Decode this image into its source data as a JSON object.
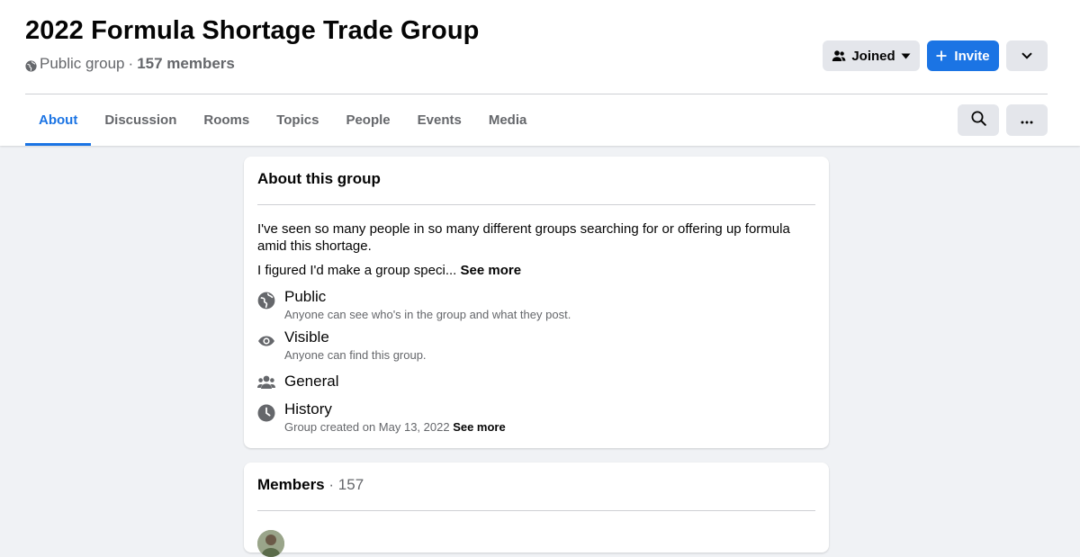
{
  "header": {
    "title": "2022 Formula Shortage Trade Group",
    "privacy": "Public group",
    "separator": "·",
    "members": "157 members"
  },
  "actions": {
    "joined_label": "Joined",
    "invite_label": "Invite"
  },
  "tabs": [
    {
      "label": "About",
      "active": true
    },
    {
      "label": "Discussion",
      "active": false
    },
    {
      "label": "Rooms",
      "active": false
    },
    {
      "label": "Topics",
      "active": false
    },
    {
      "label": "People",
      "active": false
    },
    {
      "label": "Events",
      "active": false
    },
    {
      "label": "Media",
      "active": false
    }
  ],
  "about": {
    "title": "About this group",
    "description": "I've seen so many people in so many different groups searching for or offering up formula amid this shortage.",
    "description2": "I figured I'd make a group speci...",
    "see_more": "See more",
    "items": [
      {
        "icon": "globe-icon",
        "title": "Public",
        "desc": "Anyone can see who's in the group and what they post."
      },
      {
        "icon": "eye-icon",
        "title": "Visible",
        "desc": "Anyone can find this group."
      },
      {
        "icon": "people-icon",
        "title": "General",
        "desc": ""
      },
      {
        "icon": "clock-icon",
        "title": "History",
        "desc": "Group created on May 13, 2022",
        "see_more": "See more"
      }
    ]
  },
  "members": {
    "title": "Members",
    "separator": "·",
    "count": "157"
  },
  "colors": {
    "accent": "#1b74e4",
    "background": "#f0f2f5",
    "secondary_text": "#65676b",
    "button_gray": "#e4e6eb"
  }
}
